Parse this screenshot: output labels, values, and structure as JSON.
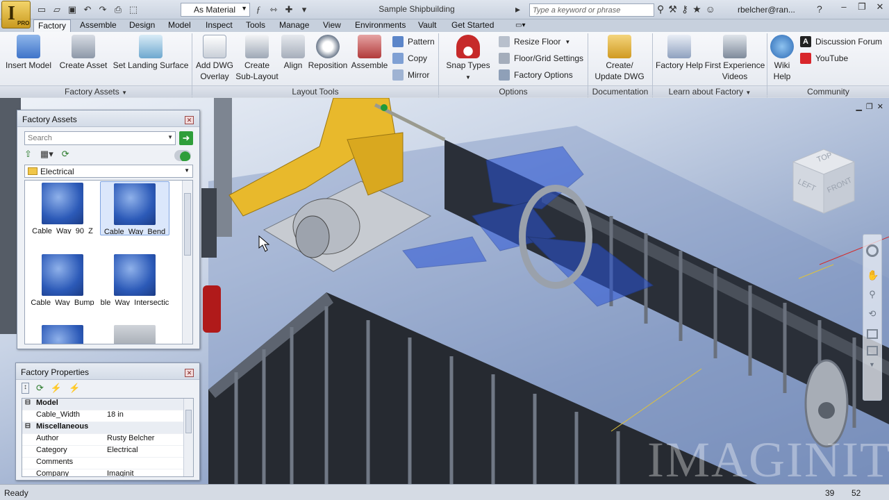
{
  "title": "Sample Shipbuilding",
  "app_badge": "PRO",
  "material": "As Material",
  "search_placeholder": "Type a keyword or phrase",
  "user": "rbelcher@ran...",
  "tabs": [
    "Factory",
    "Assemble",
    "Design",
    "Model",
    "Inspect",
    "Tools",
    "Manage",
    "View",
    "Environments",
    "Vault",
    "Get Started"
  ],
  "ribbon": {
    "factory_assets": {
      "label": "Factory Assets",
      "buttons": [
        "Insert Model",
        "Create Asset",
        "Set Landing Surface"
      ]
    },
    "layout_tools": {
      "label": "Layout Tools",
      "buttons": [
        {
          "line1": "Add DWG",
          "line2": "Overlay"
        },
        {
          "line1": "Create",
          "line2": "Sub-Layout"
        },
        {
          "line1": "Align",
          "line2": ""
        },
        {
          "line1": "Reposition",
          "line2": ""
        },
        {
          "line1": "Assemble",
          "line2": ""
        }
      ],
      "small": [
        "Pattern",
        "Copy",
        "Mirror"
      ]
    },
    "options": {
      "label": "Options",
      "snap": "Snap Types",
      "small": [
        "Resize Floor",
        "Floor/Grid Settings",
        "Factory Options"
      ]
    },
    "documentation": {
      "label": "Documentation",
      "line1": "Create/",
      "line2": "Update DWG"
    },
    "learn": {
      "label": "Learn about Factory",
      "help": "Factory Help",
      "videos_line1": "First Experience",
      "videos_line2": "Videos"
    },
    "community": {
      "label": "Community",
      "wiki_line1": "Wiki",
      "wiki_line2": "Help",
      "forum": "Discussion Forum",
      "youtube": "YouTube"
    }
  },
  "assets_panel": {
    "title": "Factory Assets",
    "search_placeholder": "Search",
    "category": "Electrical",
    "items": [
      "Cable_Way_90_Z",
      "Cable_Way_Bend",
      "Cable_Way_Bump",
      "ble_Way_Intersectic"
    ],
    "selected": "Cable_Way_Bend"
  },
  "props_panel": {
    "title": "Factory Properties",
    "groups": [
      {
        "name": "Model",
        "rows": [
          {
            "k": "Cable_Width",
            "v": "18 in"
          }
        ]
      },
      {
        "name": "Miscellaneous",
        "rows": [
          {
            "k": "Author",
            "v": "Rusty Belcher"
          },
          {
            "k": "Category",
            "v": "Electrical"
          },
          {
            "k": "Comments",
            "v": ""
          },
          {
            "k": "Company",
            "v": "Imaginit"
          }
        ]
      }
    ]
  },
  "viewcube": {
    "top": "TOP",
    "left": "LEFT",
    "front": "FRONT"
  },
  "watermark": "IMAGINIT",
  "status": {
    "text": "Ready",
    "x": "39",
    "y": "52"
  },
  "colors": {
    "accent": "#2f9e3a",
    "duct": "#e8b92c",
    "cable_way": "#2a55d6"
  }
}
